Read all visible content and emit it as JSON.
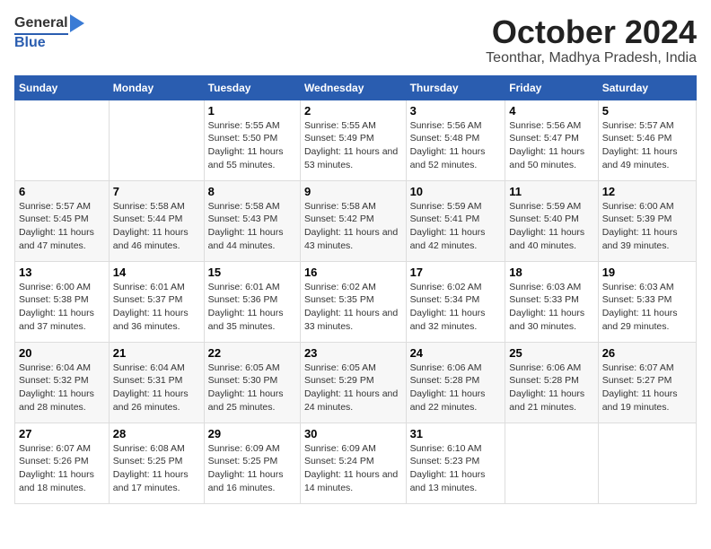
{
  "header": {
    "logo_general": "General",
    "logo_blue": "Blue",
    "title": "October 2024",
    "subtitle": "Teonthar, Madhya Pradesh, India"
  },
  "calendar": {
    "days_of_week": [
      "Sunday",
      "Monday",
      "Tuesday",
      "Wednesday",
      "Thursday",
      "Friday",
      "Saturday"
    ],
    "weeks": [
      [
        {
          "day": "",
          "sunrise": "",
          "sunset": "",
          "daylight": ""
        },
        {
          "day": "",
          "sunrise": "",
          "sunset": "",
          "daylight": ""
        },
        {
          "day": "1",
          "sunrise": "Sunrise: 5:55 AM",
          "sunset": "Sunset: 5:50 PM",
          "daylight": "Daylight: 11 hours and 55 minutes."
        },
        {
          "day": "2",
          "sunrise": "Sunrise: 5:55 AM",
          "sunset": "Sunset: 5:49 PM",
          "daylight": "Daylight: 11 hours and 53 minutes."
        },
        {
          "day": "3",
          "sunrise": "Sunrise: 5:56 AM",
          "sunset": "Sunset: 5:48 PM",
          "daylight": "Daylight: 11 hours and 52 minutes."
        },
        {
          "day": "4",
          "sunrise": "Sunrise: 5:56 AM",
          "sunset": "Sunset: 5:47 PM",
          "daylight": "Daylight: 11 hours and 50 minutes."
        },
        {
          "day": "5",
          "sunrise": "Sunrise: 5:57 AM",
          "sunset": "Sunset: 5:46 PM",
          "daylight": "Daylight: 11 hours and 49 minutes."
        }
      ],
      [
        {
          "day": "6",
          "sunrise": "Sunrise: 5:57 AM",
          "sunset": "Sunset: 5:45 PM",
          "daylight": "Daylight: 11 hours and 47 minutes."
        },
        {
          "day": "7",
          "sunrise": "Sunrise: 5:58 AM",
          "sunset": "Sunset: 5:44 PM",
          "daylight": "Daylight: 11 hours and 46 minutes."
        },
        {
          "day": "8",
          "sunrise": "Sunrise: 5:58 AM",
          "sunset": "Sunset: 5:43 PM",
          "daylight": "Daylight: 11 hours and 44 minutes."
        },
        {
          "day": "9",
          "sunrise": "Sunrise: 5:58 AM",
          "sunset": "Sunset: 5:42 PM",
          "daylight": "Daylight: 11 hours and 43 minutes."
        },
        {
          "day": "10",
          "sunrise": "Sunrise: 5:59 AM",
          "sunset": "Sunset: 5:41 PM",
          "daylight": "Daylight: 11 hours and 42 minutes."
        },
        {
          "day": "11",
          "sunrise": "Sunrise: 5:59 AM",
          "sunset": "Sunset: 5:40 PM",
          "daylight": "Daylight: 11 hours and 40 minutes."
        },
        {
          "day": "12",
          "sunrise": "Sunrise: 6:00 AM",
          "sunset": "Sunset: 5:39 PM",
          "daylight": "Daylight: 11 hours and 39 minutes."
        }
      ],
      [
        {
          "day": "13",
          "sunrise": "Sunrise: 6:00 AM",
          "sunset": "Sunset: 5:38 PM",
          "daylight": "Daylight: 11 hours and 37 minutes."
        },
        {
          "day": "14",
          "sunrise": "Sunrise: 6:01 AM",
          "sunset": "Sunset: 5:37 PM",
          "daylight": "Daylight: 11 hours and 36 minutes."
        },
        {
          "day": "15",
          "sunrise": "Sunrise: 6:01 AM",
          "sunset": "Sunset: 5:36 PM",
          "daylight": "Daylight: 11 hours and 35 minutes."
        },
        {
          "day": "16",
          "sunrise": "Sunrise: 6:02 AM",
          "sunset": "Sunset: 5:35 PM",
          "daylight": "Daylight: 11 hours and 33 minutes."
        },
        {
          "day": "17",
          "sunrise": "Sunrise: 6:02 AM",
          "sunset": "Sunset: 5:34 PM",
          "daylight": "Daylight: 11 hours and 32 minutes."
        },
        {
          "day": "18",
          "sunrise": "Sunrise: 6:03 AM",
          "sunset": "Sunset: 5:33 PM",
          "daylight": "Daylight: 11 hours and 30 minutes."
        },
        {
          "day": "19",
          "sunrise": "Sunrise: 6:03 AM",
          "sunset": "Sunset: 5:33 PM",
          "daylight": "Daylight: 11 hours and 29 minutes."
        }
      ],
      [
        {
          "day": "20",
          "sunrise": "Sunrise: 6:04 AM",
          "sunset": "Sunset: 5:32 PM",
          "daylight": "Daylight: 11 hours and 28 minutes."
        },
        {
          "day": "21",
          "sunrise": "Sunrise: 6:04 AM",
          "sunset": "Sunset: 5:31 PM",
          "daylight": "Daylight: 11 hours and 26 minutes."
        },
        {
          "day": "22",
          "sunrise": "Sunrise: 6:05 AM",
          "sunset": "Sunset: 5:30 PM",
          "daylight": "Daylight: 11 hours and 25 minutes."
        },
        {
          "day": "23",
          "sunrise": "Sunrise: 6:05 AM",
          "sunset": "Sunset: 5:29 PM",
          "daylight": "Daylight: 11 hours and 24 minutes."
        },
        {
          "day": "24",
          "sunrise": "Sunrise: 6:06 AM",
          "sunset": "Sunset: 5:28 PM",
          "daylight": "Daylight: 11 hours and 22 minutes."
        },
        {
          "day": "25",
          "sunrise": "Sunrise: 6:06 AM",
          "sunset": "Sunset: 5:28 PM",
          "daylight": "Daylight: 11 hours and 21 minutes."
        },
        {
          "day": "26",
          "sunrise": "Sunrise: 6:07 AM",
          "sunset": "Sunset: 5:27 PM",
          "daylight": "Daylight: 11 hours and 19 minutes."
        }
      ],
      [
        {
          "day": "27",
          "sunrise": "Sunrise: 6:07 AM",
          "sunset": "Sunset: 5:26 PM",
          "daylight": "Daylight: 11 hours and 18 minutes."
        },
        {
          "day": "28",
          "sunrise": "Sunrise: 6:08 AM",
          "sunset": "Sunset: 5:25 PM",
          "daylight": "Daylight: 11 hours and 17 minutes."
        },
        {
          "day": "29",
          "sunrise": "Sunrise: 6:09 AM",
          "sunset": "Sunset: 5:25 PM",
          "daylight": "Daylight: 11 hours and 16 minutes."
        },
        {
          "day": "30",
          "sunrise": "Sunrise: 6:09 AM",
          "sunset": "Sunset: 5:24 PM",
          "daylight": "Daylight: 11 hours and 14 minutes."
        },
        {
          "day": "31",
          "sunrise": "Sunrise: 6:10 AM",
          "sunset": "Sunset: 5:23 PM",
          "daylight": "Daylight: 11 hours and 13 minutes."
        },
        {
          "day": "",
          "sunrise": "",
          "sunset": "",
          "daylight": ""
        },
        {
          "day": "",
          "sunrise": "",
          "sunset": "",
          "daylight": ""
        }
      ]
    ]
  }
}
